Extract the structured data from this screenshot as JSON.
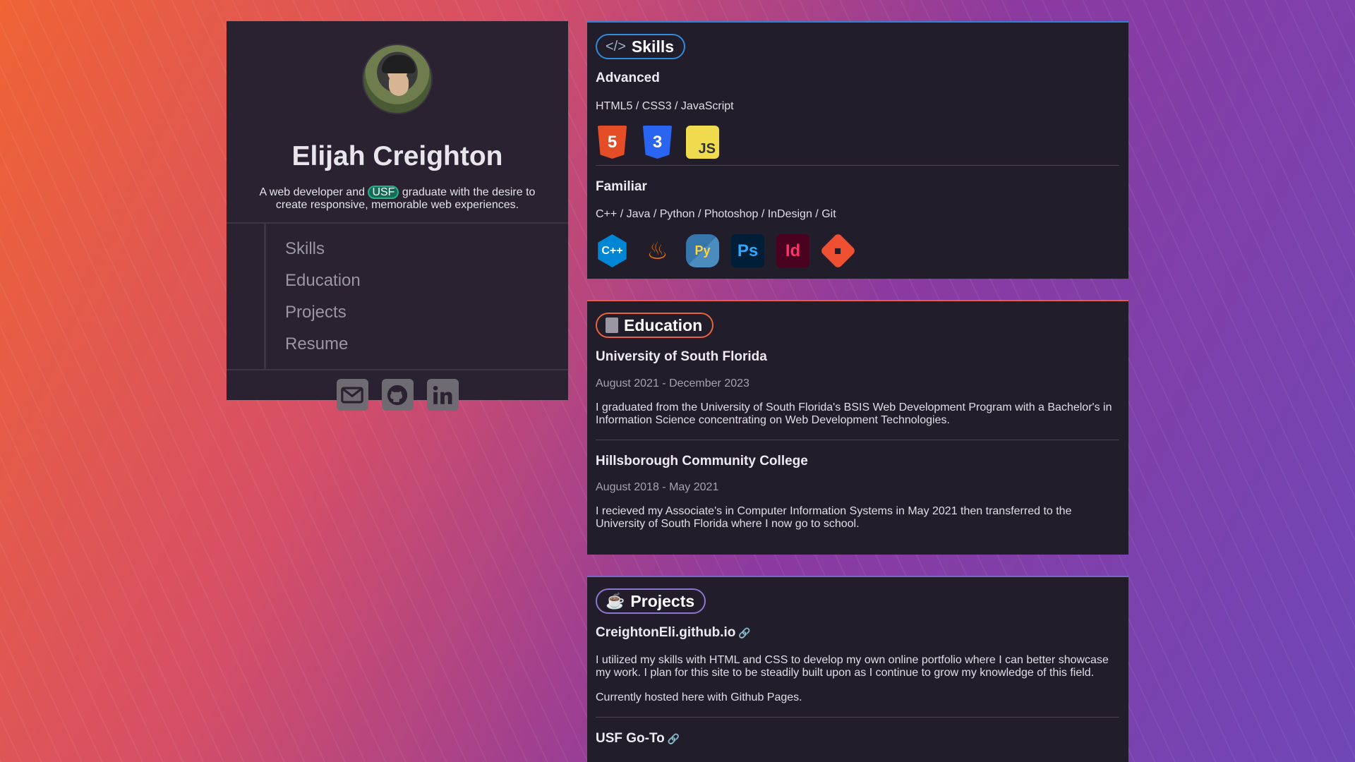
{
  "profile": {
    "name": "Elijah Creighton",
    "bio_pre": "A web developer and ",
    "bio_badge": "USF",
    "bio_post": " graduate with the desire to create responsive, memorable web experiences.",
    "nav": [
      "Skills",
      "Education",
      "Projects",
      "Resume"
    ],
    "socials": [
      "email-icon",
      "github-icon",
      "linkedin-icon"
    ]
  },
  "skills": {
    "title": "Skills",
    "advanced_heading": "Advanced",
    "advanced_list": "HTML5 / CSS3 / JavaScript",
    "advanced_icons": [
      {
        "name": "html5-icon",
        "label": "5",
        "color": "#e44d26"
      },
      {
        "name": "css3-icon",
        "label": "3",
        "color": "#2965f1"
      },
      {
        "name": "javascript-icon",
        "label": "JS",
        "color": "#f0db4f"
      }
    ],
    "familiar_heading": "Familiar",
    "familiar_list": "C++ / Java / Python / Photoshop / InDesign / Git",
    "familiar_icons": [
      {
        "name": "cplusplus-icon",
        "label": "C++",
        "color": "#0086d4"
      },
      {
        "name": "java-icon",
        "label": "♨",
        "color": "#e76f00"
      },
      {
        "name": "python-icon",
        "label": "Py",
        "color": "#3776ab"
      },
      {
        "name": "photoshop-icon",
        "label": "Ps",
        "color": "#31a8ff"
      },
      {
        "name": "indesign-icon",
        "label": "Id",
        "color": "#ff3366"
      },
      {
        "name": "git-icon",
        "label": "◆",
        "color": "#f05032"
      }
    ]
  },
  "education": {
    "title": "Education",
    "entries": [
      {
        "school": "University of South Florida",
        "dates": "August 2021 - December 2023",
        "desc": "I graduated from the University of South Florida's BSIS Web Development Program with a Bachelor's in Information Science concentrating on Web Development Technologies."
      },
      {
        "school": "Hillsborough Community College",
        "dates": "August 2018 - May 2021",
        "desc": "I recieved my Associate's in Computer Information Systems in May 2021 then transferred to the University of South Florida where I now go to school."
      }
    ]
  },
  "projects": {
    "title": "Projects",
    "entries": [
      {
        "name": "CreightonEli.github.io",
        "desc": "I utilized my skills with HTML and CSS to develop my own online portfolio where I can better showcase my work. I plan for this site to be steadily built upon as I continue to grow my knowledge of this field.",
        "note": "Currently hosted here with Github Pages."
      },
      {
        "name": "USF Go-To"
      }
    ]
  }
}
